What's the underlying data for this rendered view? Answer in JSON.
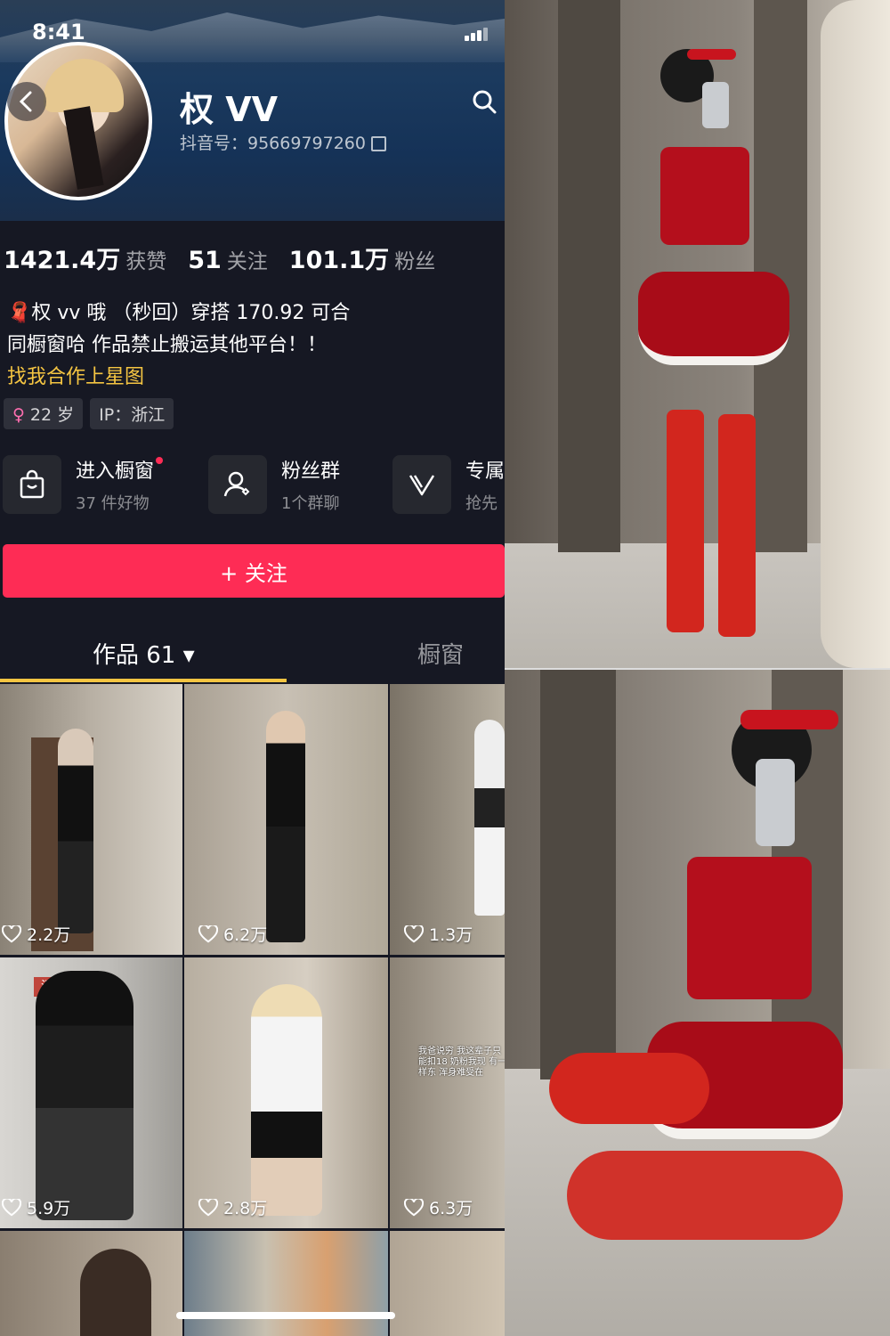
{
  "status_bar": {
    "time": "8:41"
  },
  "profile": {
    "name": "权 VV",
    "douyin_id": "抖音号：95669797260",
    "stats": [
      {
        "value": "1421.4万",
        "label": "获赞"
      },
      {
        "value": "51",
        "label": "关注"
      },
      {
        "value": "101.1万",
        "label": "粉丝"
      }
    ],
    "bio_line1": "权 vv 哦 （秒回）穿搭 170.92 可合",
    "bio_line2": "同橱窗哈  作品禁止搬运其他平台！！",
    "bio_link": "找我合作上星图",
    "tag_age": "22 岁",
    "tag_ip": "IP：浙江"
  },
  "services": [
    {
      "title": "进入橱窗",
      "sub": "37 件好物"
    },
    {
      "title": "粉丝群",
      "sub": "1个群聊"
    },
    {
      "title": "专属",
      "sub": "抢先"
    }
  ],
  "follow_label": "+ 关注",
  "tabs": {
    "works": "作品 61 ▾",
    "shop": "橱窗"
  },
  "videos": [
    {
      "likes": "2.2万"
    },
    {
      "likes": "6.2万"
    },
    {
      "likes": "1.3万"
    },
    {
      "likes": "5.9万"
    },
    {
      "likes": "2.8万"
    },
    {
      "likes": "6.3万"
    }
  ],
  "thumb_text": {
    "sign": "消火",
    "overlay": "我爸说穷 我这辈子只能扣18 奶粉我现 有一样东 浑身难受在"
  },
  "colors": {
    "accent": "#fe2c55",
    "gold": "#f5c542",
    "background": "#161823"
  }
}
